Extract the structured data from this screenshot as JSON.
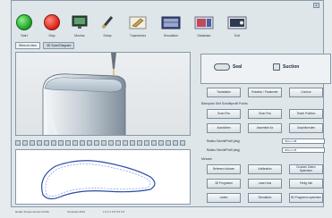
{
  "window": {
    "title": "",
    "close_glyph": "x"
  },
  "toolbar": {
    "items": [
      {
        "label": "Start",
        "icon": "green-circle-icon"
      },
      {
        "label": "Stop",
        "icon": "red-circle-icon"
      },
      {
        "label": "Monitor",
        "icon": "monitor-icon"
      },
      {
        "label": "Setup",
        "icon": "pen-icon"
      },
      {
        "label": "Trajectories",
        "icon": "paint-icon"
      },
      {
        "label": "Simulation",
        "icon": "simulation-icon"
      },
      {
        "label": "Database",
        "icon": "database-icon"
      },
      {
        "label": "Exit",
        "icon": "exit-icon"
      }
    ]
  },
  "tabs": [
    "Wirecut view",
    "3D Scan/Diagram"
  ],
  "modes": {
    "left": "Seal",
    "right": "Suction"
  },
  "top_buttons": [
    "Translation",
    "Rotation / Parameter",
    "Contour"
  ],
  "section1": {
    "title": "Bahnplan Seit Schnittprofil Points",
    "buttons": [
      "Scan Pos",
      "Scan Pos",
      "Teach Position",
      "Ausrichten",
      "Assemble Ax",
      "Graphikenden"
    ]
  },
  "fields": [
    {
      "label": "Radius Schnitt/Profil (deg)",
      "value": "JPos:1 98"
    },
    {
      "label": "Radius Schnitt/Profil (deg)",
      "value": "JPos:1 25"
    }
  ],
  "section2": {
    "title": "Messen",
    "buttons": [
      "Referenz Achsen",
      "Kalibration",
      "Drucken Daten Speichern",
      "3D Programm",
      "Laser Aus",
      "Fertig Info",
      "Laden",
      "Simulation",
      "3D Programm speichern"
    ]
  },
  "status": [
    "Ready Simple Device Profile",
    "Toolscale 2001",
    "1.0  0.1  0.5 0.5 0.5"
  ],
  "colors": {
    "accent": "#1e9c26",
    "stop": "#d81e12",
    "frame": "#dfe6ea"
  }
}
